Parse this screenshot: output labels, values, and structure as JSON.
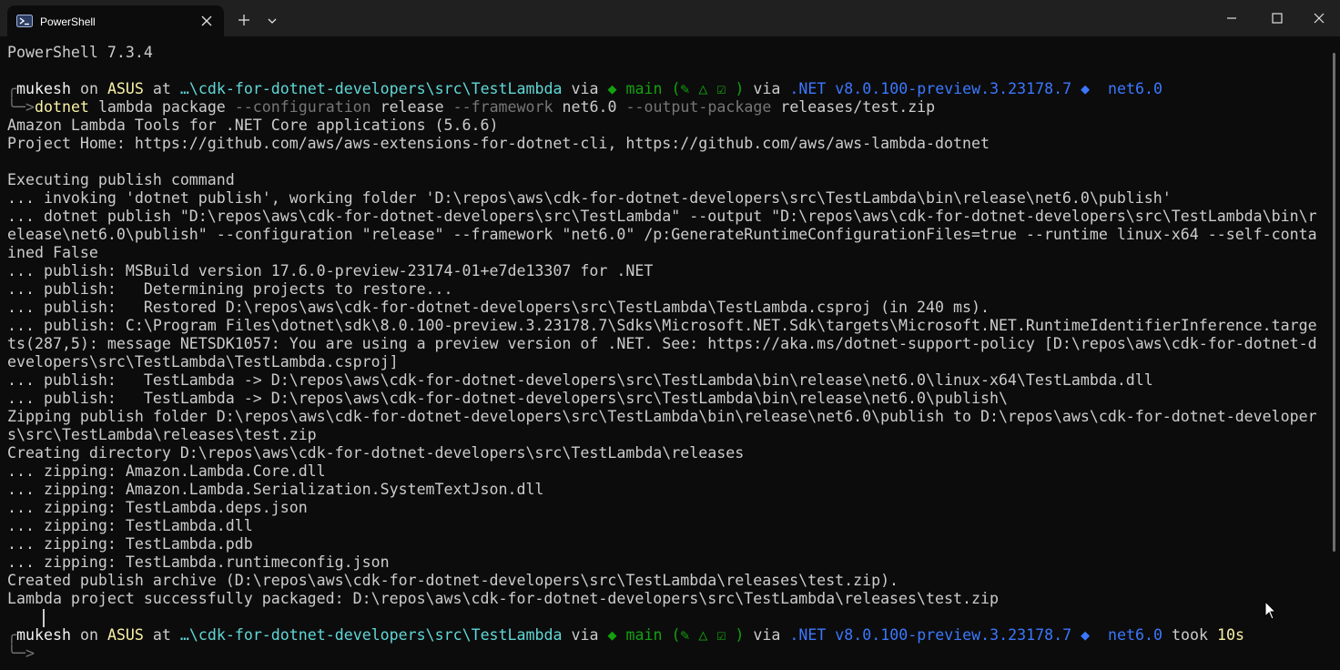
{
  "window": {
    "tab_title": "PowerShell"
  },
  "prompt1": {
    "user": "mukesh",
    "on": "on",
    "host": "ASUS",
    "at": "at",
    "path": "…\\cdk-for-dotnet-developers\\src\\TestLambda",
    "via": "via",
    "branch_symbol": "◆",
    "branch": "main",
    "git_status": "(✎ △ ☑ )",
    "via2": "via",
    "dotnet": ".NET v8.0.100-preview.3.23178.7",
    "diamond": "◆",
    "framework": "net6.0",
    "arrow": "╰─>",
    "command": {
      "exe": "dotnet",
      "a1": "lambda package",
      "f1": "--configuration",
      "a2": "release",
      "f2": "--framework",
      "a3": "net6.0",
      "f3": "--output-package",
      "a4": "releases/test.zip"
    }
  },
  "output_lines": [
    "PowerShell 7.3.4",
    "Amazon Lambda Tools for .NET Core applications (5.6.6)",
    "Project Home: https://github.com/aws/aws-extensions-for-dotnet-cli, https://github.com/aws/aws-lambda-dotnet",
    "Executing publish command",
    "... invoking 'dotnet publish', working folder 'D:\\repos\\aws\\cdk-for-dotnet-developers\\src\\TestLambda\\bin\\release\\net6.0\\publish'",
    "... dotnet publish \"D:\\repos\\aws\\cdk-for-dotnet-developers\\src\\TestLambda\" --output \"D:\\repos\\aws\\cdk-for-dotnet-developers\\src\\TestLambda\\bin\\r",
    "elease\\net6.0\\publish\" --configuration \"release\" --framework \"net6.0\" /p:GenerateRuntimeConfigurationFiles=true --runtime linux-x64 --self-conta",
    "ined False",
    "... publish: MSBuild version 17.6.0-preview-23174-01+e7de13307 for .NET",
    "... publish:   Determining projects to restore...",
    "... publish:   Restored D:\\repos\\aws\\cdk-for-dotnet-developers\\src\\TestLambda\\TestLambda.csproj (in 240 ms).",
    "... publish: C:\\Program Files\\dotnet\\sdk\\8.0.100-preview.3.23178.7\\Sdks\\Microsoft.NET.Sdk\\targets\\Microsoft.NET.RuntimeIdentifierInference.targe",
    "ts(287,5): message NETSDK1057: You are using a preview version of .NET. See: https://aka.ms/dotnet-support-policy [D:\\repos\\aws\\cdk-for-dotnet-d",
    "evelopers\\src\\TestLambda\\TestLambda.csproj]",
    "... publish:   TestLambda -> D:\\repos\\aws\\cdk-for-dotnet-developers\\src\\TestLambda\\bin\\release\\net6.0\\linux-x64\\TestLambda.dll",
    "... publish:   TestLambda -> D:\\repos\\aws\\cdk-for-dotnet-developers\\src\\TestLambda\\bin\\release\\net6.0\\publish\\",
    "Zipping publish folder D:\\repos\\aws\\cdk-for-dotnet-developers\\src\\TestLambda\\bin\\release\\net6.0\\publish to D:\\repos\\aws\\cdk-for-dotnet-developer",
    "s\\src\\TestLambda\\releases\\test.zip",
    "Creating directory D:\\repos\\aws\\cdk-for-dotnet-developers\\src\\TestLambda\\releases",
    "... zipping: Amazon.Lambda.Core.dll",
    "... zipping: Amazon.Lambda.Serialization.SystemTextJson.dll",
    "... zipping: TestLambda.deps.json",
    "... zipping: TestLambda.dll",
    "... zipping: TestLambda.pdb",
    "... zipping: TestLambda.runtimeconfig.json",
    "Created publish archive (D:\\repos\\aws\\cdk-for-dotnet-developers\\src\\TestLambda\\releases\\test.zip).",
    "Lambda project successfully packaged: D:\\repos\\aws\\cdk-for-dotnet-developers\\src\\TestLambda\\releases\\test.zip"
  ],
  "prompt2": {
    "took": "took",
    "duration": "10s"
  }
}
